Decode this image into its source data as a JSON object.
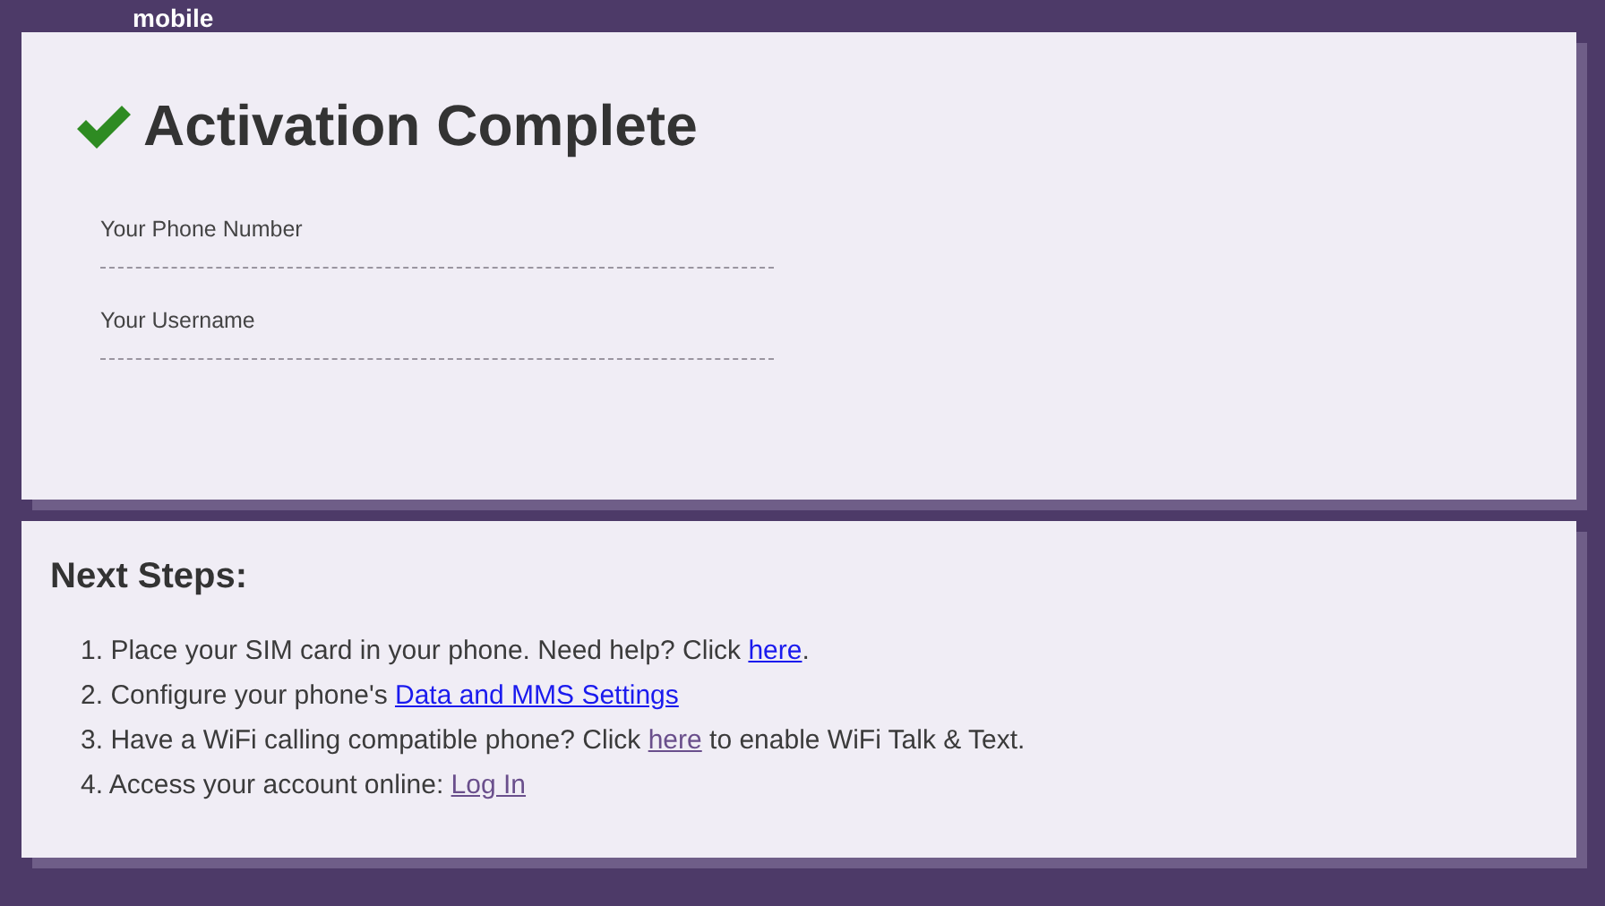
{
  "logo": "mobile",
  "title": "Activation Complete",
  "fields": [
    {
      "label": "Your Phone Number"
    },
    {
      "label": "Your Username"
    }
  ],
  "next_steps": {
    "heading": "Next Steps:",
    "items": [
      {
        "number": "1.",
        "parts": [
          {
            "kind": "text",
            "text": "Place your SIM card in your phone. Need help? Click "
          },
          {
            "kind": "link",
            "text": "here",
            "visited": false
          },
          {
            "kind": "text",
            "text": "."
          }
        ]
      },
      {
        "number": "2.",
        "parts": [
          {
            "kind": "text",
            "text": "Configure your phone's "
          },
          {
            "kind": "link",
            "text": "Data and MMS Settings",
            "visited": false
          }
        ]
      },
      {
        "number": "3.",
        "parts": [
          {
            "kind": "text",
            "text": "Have a WiFi calling compatible phone? Click "
          },
          {
            "kind": "link",
            "text": "here",
            "visited": true
          },
          {
            "kind": "text",
            "text": " to enable WiFi Talk & Text."
          }
        ]
      },
      {
        "number": "4.",
        "parts": [
          {
            "kind": "text",
            "text": "Access your account online: "
          },
          {
            "kind": "link",
            "text": "Log In",
            "visited": true
          }
        ]
      }
    ]
  }
}
